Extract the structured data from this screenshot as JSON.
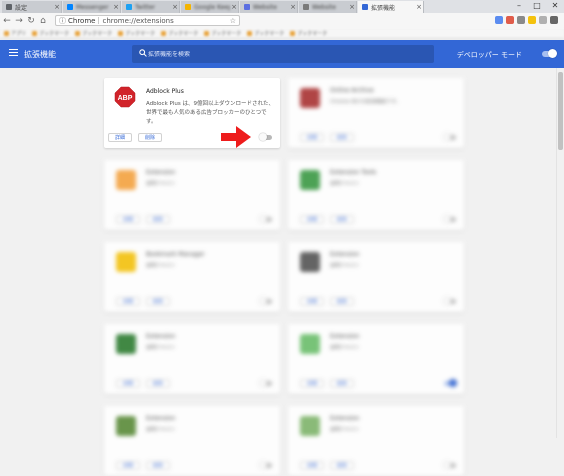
{
  "tabs": [
    {
      "label": "設定",
      "color": "#5f6368",
      "active": false,
      "blur": false
    },
    {
      "label": "Messenger",
      "color": "#0084ff",
      "active": false,
      "blur": true
    },
    {
      "label": "Twitter",
      "color": "#1da1f2",
      "active": false,
      "blur": true
    },
    {
      "label": "Google Keep",
      "color": "#f4b400",
      "active": false,
      "blur": true
    },
    {
      "label": "Website",
      "color": "#5b6ee1",
      "active": false,
      "blur": true
    },
    {
      "label": "Website",
      "color": "#7a7a7a",
      "active": false,
      "blur": true
    },
    {
      "label": "拡張機能",
      "color": "#3367d6",
      "active": true,
      "blur": false
    }
  ],
  "toolbar": {
    "chrome_label": "Chrome",
    "url": "chrome://extensions"
  },
  "bookmarks": [
    "アプリ",
    "ブックマーク",
    "ブックマーク",
    "ブックマーク",
    "ブックマーク",
    "ブックマーク",
    "ブックマーク",
    "ブックマーク"
  ],
  "header": {
    "title": "拡張機能",
    "search_placeholder": "拡張機能を検索",
    "dev_mode_label": "デベロッパー モード"
  },
  "adblock": {
    "title": "Adblock Plus",
    "description": "Adblock Plus は、9億回以上ダウンロードされた、世界で最も人気のある広告ブロッカーのひとつです。",
    "details_button": "詳細",
    "remove_button": "削除",
    "enabled": false
  },
  "extensions": [
    {
      "title": "Online Archive",
      "desc": "Chrome 向けの拡張機能です。",
      "icon_color": "#a33",
      "enabled": false
    },
    {
      "title": "Extension",
      "desc": "説明テキスト",
      "icon_color": "#f5a340",
      "enabled": false
    },
    {
      "title": "Extension Tools",
      "desc": "説明テキスト",
      "icon_color": "#3c9a45",
      "enabled": false
    },
    {
      "title": "Bookmark Manager",
      "desc": "説明テキスト",
      "icon_color": "#f4c20d",
      "enabled": false
    },
    {
      "title": "Extension",
      "desc": "説明テキスト",
      "icon_color": "#555",
      "enabled": false
    },
    {
      "title": "Extension",
      "desc": "説明テキスト",
      "icon_color": "#2e7d32",
      "enabled": false
    },
    {
      "title": "Extension",
      "desc": "説明テキスト",
      "icon_color": "#6cbf6c",
      "enabled": true
    },
    {
      "title": "Extension",
      "desc": "説明テキスト",
      "icon_color": "#5b8c3a",
      "enabled": false
    },
    {
      "title": "Extension",
      "desc": "説明テキスト",
      "icon_color": "#7fb56b",
      "enabled": false
    }
  ],
  "card_buttons": {
    "details": "詳細",
    "remove": "削除"
  }
}
